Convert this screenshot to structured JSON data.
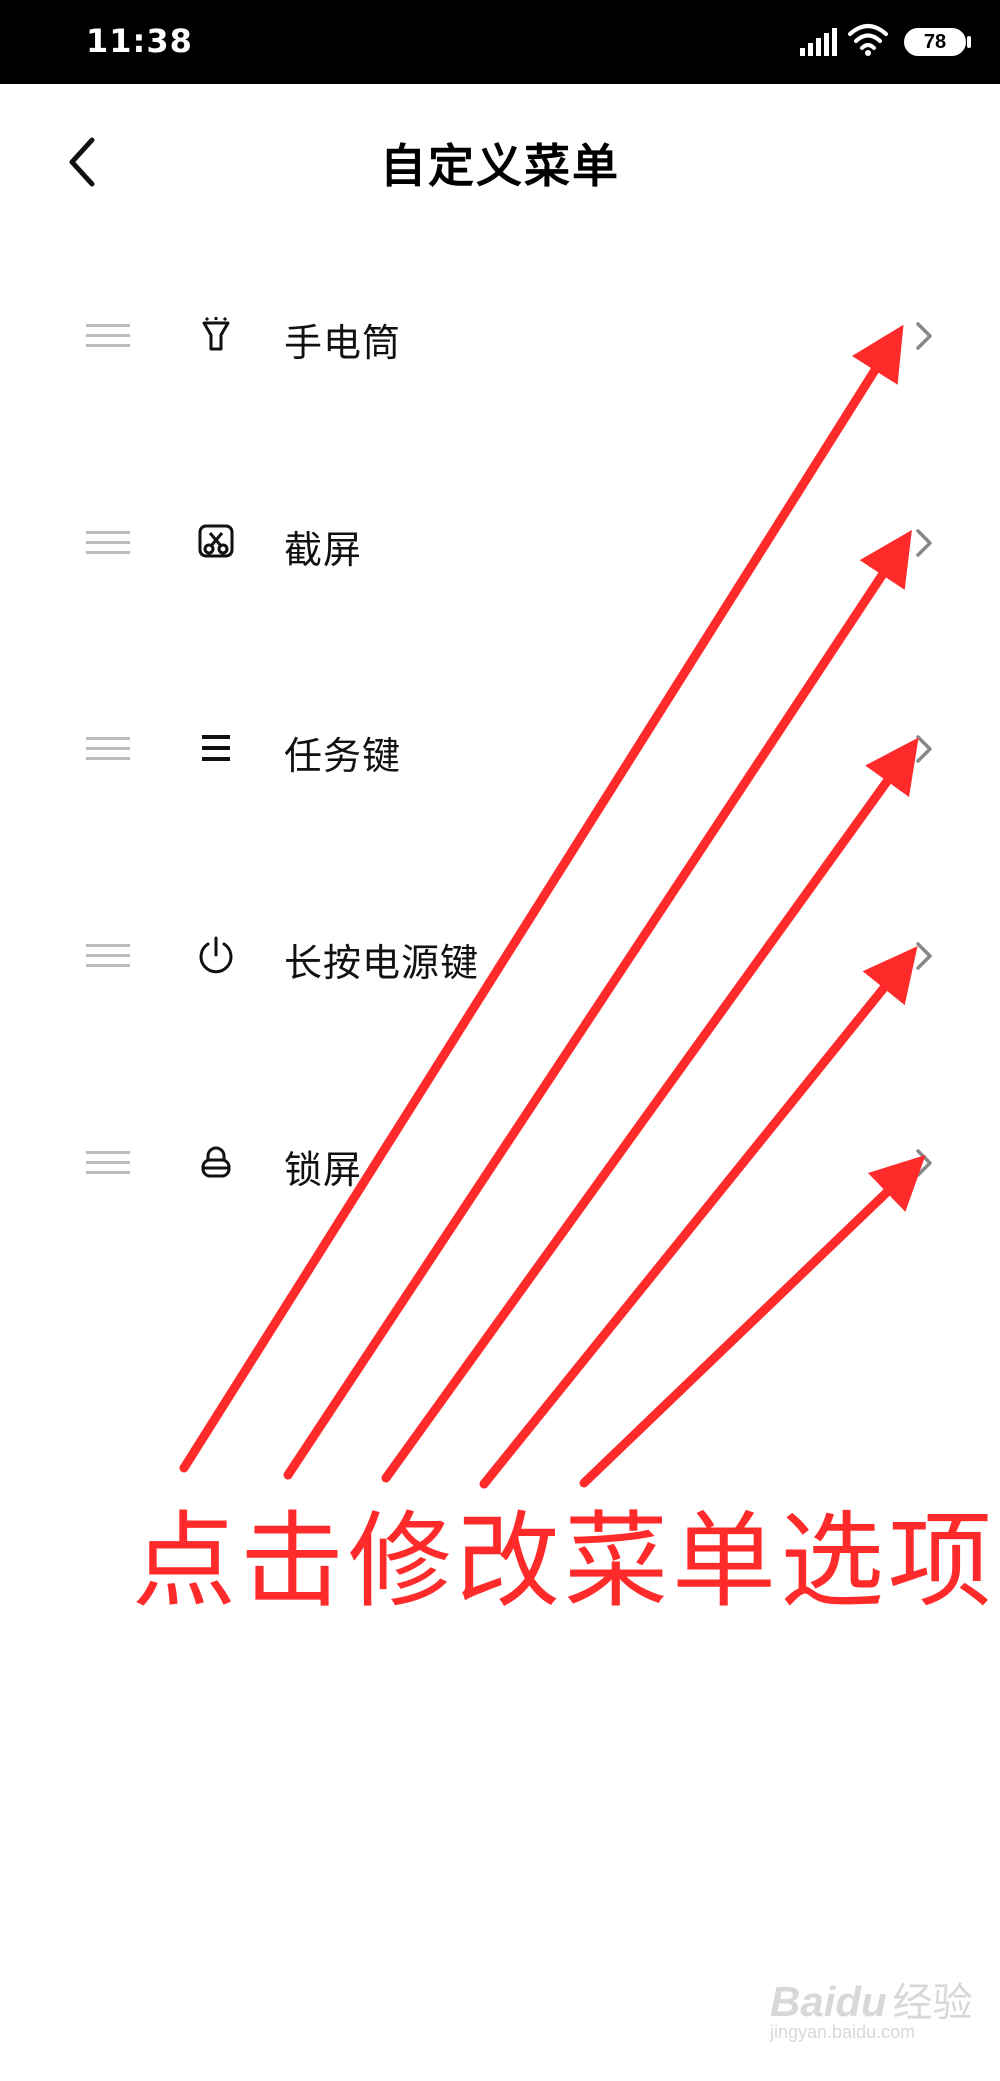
{
  "status_bar": {
    "time": "11:38",
    "battery": "78"
  },
  "header": {
    "title": "自定义菜单"
  },
  "menu": {
    "items": [
      {
        "label": "手电筒",
        "icon": "flashlight-icon"
      },
      {
        "label": "截屏",
        "icon": "screenshot-icon"
      },
      {
        "label": "任务键",
        "icon": "menu-lines-icon"
      },
      {
        "label": "长按电源键",
        "icon": "power-icon"
      },
      {
        "label": "锁屏",
        "icon": "lock-icon"
      }
    ]
  },
  "annotation": {
    "text": "点击修改菜单选项",
    "color": "#ff2a2a"
  },
  "watermark": {
    "brand": "Baidu",
    "sub": "经验",
    "url": "jingyan.baidu.com"
  }
}
